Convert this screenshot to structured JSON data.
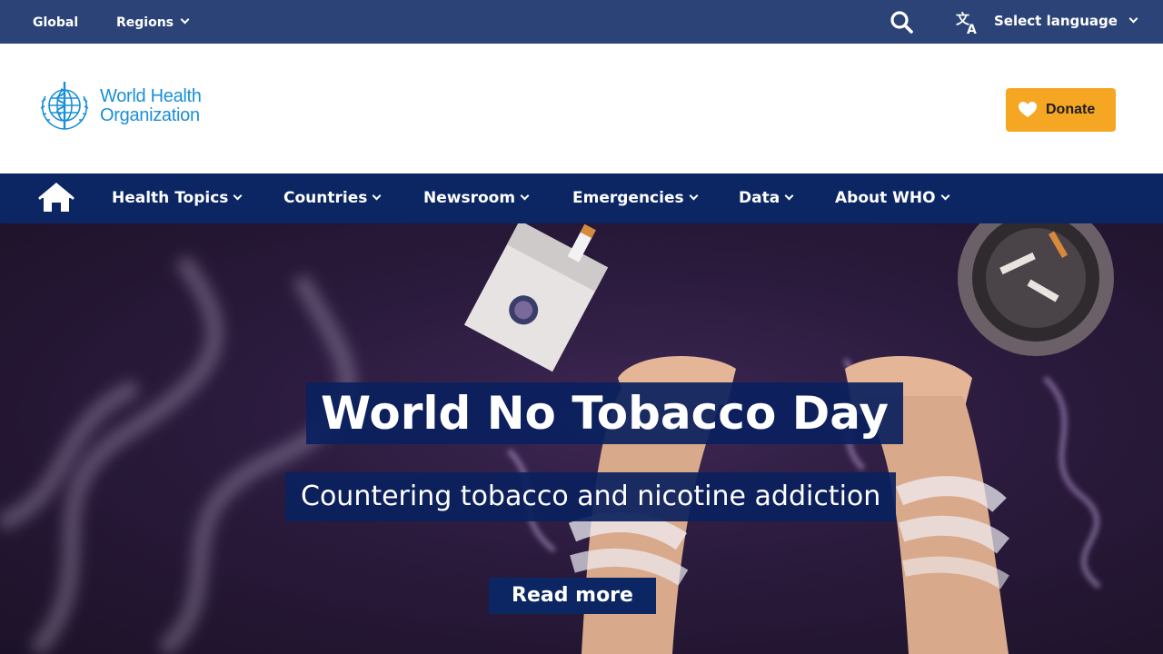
{
  "topbar": {
    "global_label": "Global",
    "regions_label": "Regions",
    "language_label": "Select language"
  },
  "header": {
    "logo_line1": "World Health",
    "logo_line2": "Organization",
    "donate_label": "Donate"
  },
  "nav": {
    "items": [
      {
        "label": "Health Topics"
      },
      {
        "label": "Countries"
      },
      {
        "label": "Newsroom"
      },
      {
        "label": "Emergencies"
      },
      {
        "label": "Data"
      },
      {
        "label": "About WHO"
      }
    ]
  },
  "hero": {
    "title": "World No Tobacco Day",
    "subtitle": "Countering tobacco and nicotine addiction",
    "cta": "Read more"
  },
  "colors": {
    "topbar": "#2b4377",
    "nav": "#0b2663",
    "donate": "#f5a623",
    "logo": "#1a8fd8"
  },
  "icons": [
    "search-icon",
    "translate-icon",
    "heart-icon",
    "home-icon",
    "chevron-down-icon"
  ]
}
